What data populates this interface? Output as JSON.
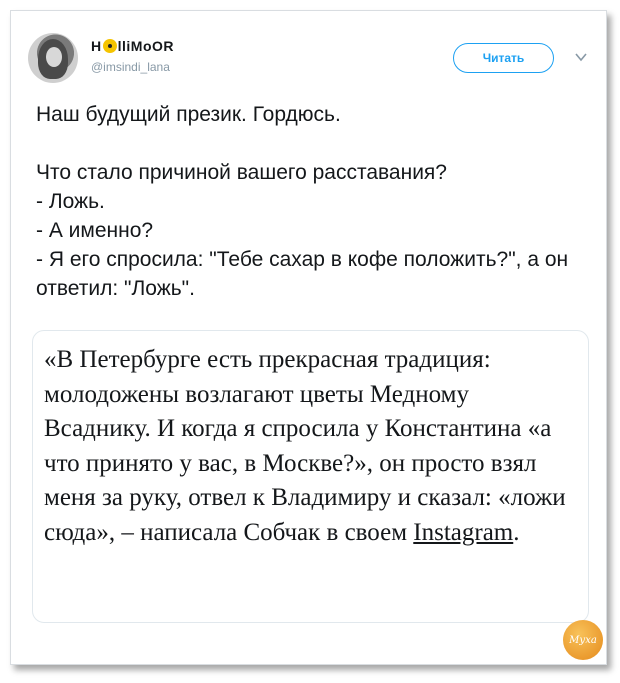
{
  "tweet": {
    "author": {
      "name_prefix": "H",
      "name_suffix": "lliMoOR",
      "handle": "@imsindi_lana"
    },
    "follow_label": "Читать",
    "text": "Наш будущий презик. Гордюсь.\n\nЧто стало причиной вашего расставания?\n- Ложь.\n- А именно?\n- Я его спросила: \"Тебе сахар в кофе положить?\", а он ответил: \"Ложь\".",
    "quote": {
      "text_main": "«В Петербурге есть прекрасная традиция: молодожены возлагают цветы Медному Всаднику. И когда я спросила у Константина «а что принято у вас, в Москве?», он просто взял меня за руку, отвел к Владимиру и сказал: «ложи сюда», – написала Собчак в своем ",
      "link": "Instagram",
      "text_end": "."
    }
  },
  "watermark": {
    "text": "Муха"
  },
  "icons": {
    "radiation": "radiation-icon",
    "chevron": "chevron-down-icon"
  },
  "colors": {
    "accent": "#1da1f2",
    "text": "#14171a",
    "muted": "#8899a6",
    "radiation": "#f5c400",
    "logo": "#e58a1c"
  }
}
